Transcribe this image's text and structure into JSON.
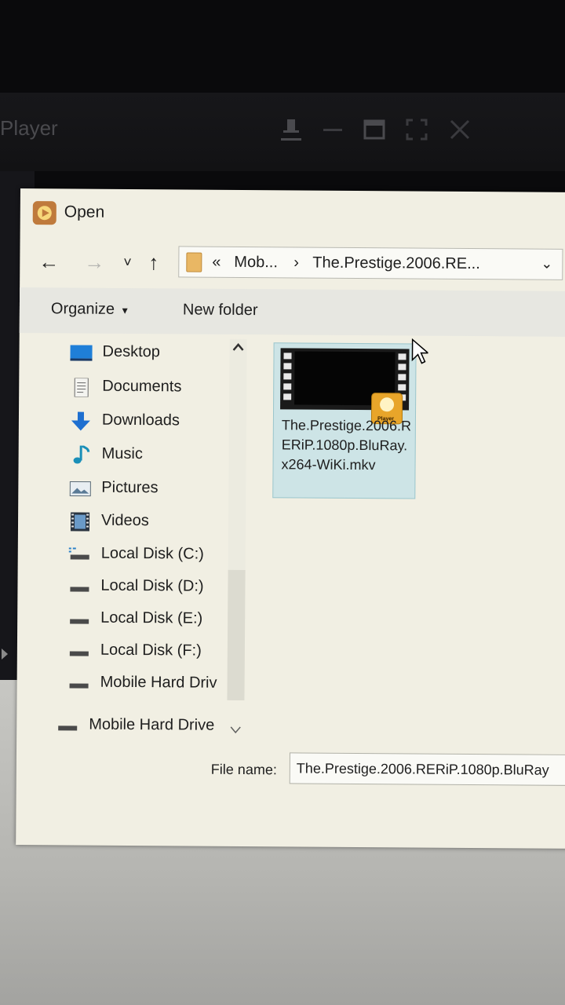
{
  "player": {
    "title": "Player",
    "controls": [
      "pin-icon",
      "minimize-icon",
      "maximize-icon",
      "fullscreen-icon",
      "close-icon"
    ]
  },
  "dialog": {
    "title": "Open",
    "nav": {
      "back": "←",
      "forward": "→",
      "recent": "˅",
      "up": "↑"
    },
    "address": {
      "overflow": "«",
      "crumb1": "Mob...",
      "separator": "›",
      "crumb2": "The.Prestige.2006.RE...",
      "dropdown": "⌄"
    },
    "toolbar": {
      "organize": "Organize",
      "organize_arrow": "▾",
      "new_folder": "New folder"
    },
    "nav_pane": {
      "items": [
        {
          "label": "Desktop",
          "icon": "desktop-icon"
        },
        {
          "label": "Documents",
          "icon": "documents-icon"
        },
        {
          "label": "Downloads",
          "icon": "downloads-icon"
        },
        {
          "label": "Music",
          "icon": "music-icon"
        },
        {
          "label": "Pictures",
          "icon": "pictures-icon"
        },
        {
          "label": "Videos",
          "icon": "videos-icon"
        },
        {
          "label": "Local Disk (C:)",
          "icon": "drive-icon"
        },
        {
          "label": "Local Disk (D:)",
          "icon": "drive-icon"
        },
        {
          "label": "Local Disk (E:)",
          "icon": "drive-icon"
        },
        {
          "label": "Local Disk (F:)",
          "icon": "drive-icon"
        },
        {
          "label": "Mobile Hard Driv",
          "icon": "drive-icon"
        },
        {
          "label": "Mobile Hard Drive",
          "icon": "drive-icon"
        }
      ]
    },
    "files": [
      {
        "name": "The.Prestige.2006.RERiP.1080p.BluRay.x264-WiKi.mkv",
        "badge": "Player",
        "selected": true
      }
    ],
    "file_name": {
      "label": "File name:",
      "value": "The.Prestige.2006.RERiP.1080p.BluRay"
    }
  }
}
